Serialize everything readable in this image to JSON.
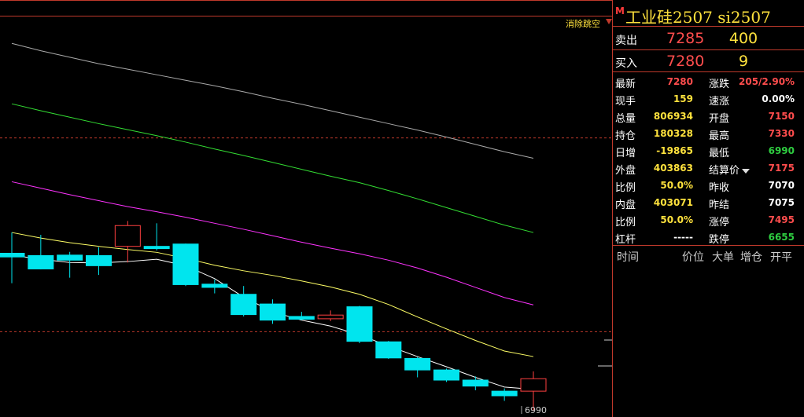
{
  "chart": {
    "clear_gap_label": "消除跳空",
    "bottom_price_label": "6990"
  },
  "chart_data": {
    "type": "candlestick",
    "candles": [
      {
        "open": 7245,
        "close": 7237,
        "high": 7290,
        "low": 7180
      },
      {
        "open": 7240,
        "close": 7211,
        "high": 7285,
        "low": 7210
      },
      {
        "open": 7241,
        "close": 7230,
        "high": 7248,
        "low": 7192
      },
      {
        "open": 7240,
        "close": 7218,
        "high": 7258,
        "low": 7198
      },
      {
        "open": 7260,
        "close": 7305,
        "high": 7315,
        "low": 7225
      },
      {
        "open": 7260,
        "close": 7255,
        "high": 7310,
        "low": 7251
      },
      {
        "open": 7265,
        "close": 7177,
        "high": 7266,
        "low": 7174
      },
      {
        "open": 7178,
        "close": 7171,
        "high": 7188,
        "low": 7158
      },
      {
        "open": 7156,
        "close": 7112,
        "high": 7174,
        "low": 7108
      },
      {
        "open": 7135,
        "close": 7100,
        "high": 7145,
        "low": 7092
      },
      {
        "open": 7108,
        "close": 7102,
        "high": 7118,
        "low": 7100
      },
      {
        "open": 7103,
        "close": 7111,
        "high": 7121,
        "low": 7098
      },
      {
        "open": 7129,
        "close": 7054,
        "high": 7131,
        "low": 7050
      },
      {
        "open": 7053,
        "close": 7018,
        "high": 7055,
        "low": 7016
      },
      {
        "open": 7017,
        "close": 6992,
        "high": 7020,
        "low": 6976
      },
      {
        "open": 6992,
        "close": 6970,
        "high": 6995,
        "low": 6966
      },
      {
        "open": 6970,
        "close": 6957,
        "high": 6978,
        "low": 6948
      },
      {
        "open": 6946,
        "close": 6936,
        "high": 6952,
        "low": 6925
      },
      {
        "open": 6946,
        "close": 6973,
        "high": 6989,
        "low": 6903
      }
    ],
    "ma_lines": [
      {
        "color": "#ffffff",
        "values": [
          7241,
          7232,
          7225,
          7224,
          7227,
          7232,
          7218,
          7190,
          7150,
          7118,
          7100,
          7087,
          7068,
          7044,
          7021,
          6999,
          6976,
          6955,
          6950
        ]
      },
      {
        "color": "#ffff66",
        "values": [
          7290,
          7278,
          7268,
          7260,
          7253,
          7247,
          7234,
          7219,
          7207,
          7197,
          7185,
          7172,
          7156,
          7134,
          7107,
          7081,
          7056,
          7033,
          7021
        ]
      },
      {
        "color": "#ff33ff",
        "values": [
          7400,
          7386,
          7372,
          7359,
          7346,
          7335,
          7323,
          7310,
          7297,
          7283,
          7269,
          7256,
          7244,
          7230,
          7213,
          7193,
          7171,
          7149,
          7133
        ]
      },
      {
        "color": "#33dd33",
        "values": [
          7569,
          7554,
          7540,
          7526,
          7513,
          7500,
          7486,
          7471,
          7457,
          7442,
          7427,
          7412,
          7398,
          7381,
          7363,
          7344,
          7325,
          7306,
          7290
        ]
      },
      {
        "color": "#aaaaaa",
        "values": [
          7700,
          7684,
          7670,
          7656,
          7644,
          7632,
          7620,
          7608,
          7595,
          7581,
          7568,
          7554,
          7540,
          7526,
          7512,
          7497,
          7481,
          7465,
          7451
        ]
      }
    ],
    "ylim": [
      6890,
      7760
    ],
    "limit_up": 7495,
    "last_settle": 7075,
    "low": 6990,
    "legend": "none",
    "grid": false
  },
  "quote": {
    "marker": "M",
    "title": "工业硅2507  si2507",
    "ask_label": "卖出",
    "ask_price": "7285",
    "ask_vol": "400",
    "bid_label": "买入",
    "bid_price": "7280",
    "bid_vol": "9",
    "rows": [
      {
        "l1": "最新",
        "v1": "7280",
        "c1": "#ff4d4d",
        "l2": "涨跌",
        "v2": "205/2.90%",
        "c2": "#ff4d4d"
      },
      {
        "l1": "现手",
        "v1": "159",
        "c1": "#ffe23d",
        "l2": "速涨",
        "v2": "0.00%",
        "c2": "#ffffff"
      },
      {
        "l1": "总量",
        "v1": "806934",
        "c1": "#ffe23d",
        "l2": "开盘",
        "v2": "7150",
        "c2": "#ff4d4d"
      },
      {
        "l1": "持仓",
        "v1": "180328",
        "c1": "#ffe23d",
        "l2": "最高",
        "v2": "7330",
        "c2": "#ff4d4d"
      },
      {
        "l1": "日增",
        "v1": "-19865",
        "c1": "#ffe23d",
        "l2": "最低",
        "v2": "6990",
        "c2": "#2ecc40"
      },
      {
        "l1": "外盘",
        "v1": "403863",
        "c1": "#ffe23d",
        "l2": "结算价",
        "v2": "7175",
        "c2": "#ff4d4d",
        "dropdown": true
      },
      {
        "l1": "比例",
        "v1": "50.0%",
        "c1": "#ffe23d",
        "l2": "昨收",
        "v2": "7070",
        "c2": "#ffffff"
      },
      {
        "l1": "内盘",
        "v1": "403071",
        "c1": "#ffe23d",
        "l2": "昨结",
        "v2": "7075",
        "c2": "#ffffff"
      },
      {
        "l1": "比例",
        "v1": "50.0%",
        "c1": "#ffe23d",
        "l2": "涨停",
        "v2": "7495",
        "c2": "#ff4d4d"
      },
      {
        "l1": "杠杆",
        "v1": "-----",
        "c1": "#ffffff",
        "l2": "跌停",
        "v2": "6655",
        "c2": "#2ecc40"
      }
    ],
    "ticks_header": {
      "time": "时间",
      "price": "价位",
      "big": "大单",
      "oi": "增仓",
      "open_close": "开平"
    }
  },
  "colors": {
    "up": "#ff4040",
    "down": "#00e5ee",
    "frame": "#c0392b"
  }
}
